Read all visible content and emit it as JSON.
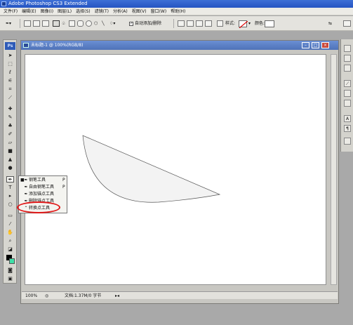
{
  "app": {
    "title": "Adobe Photoshop CS3 Extended"
  },
  "menu": [
    "文件(F)",
    "编辑(E)",
    "图像(I)",
    "图层(L)",
    "选择(S)",
    "滤镜(T)",
    "分析(A)",
    "视图(V)",
    "窗口(W)",
    "帮助(H)"
  ],
  "options": {
    "auto_add_delete_label": "自动添加/删除",
    "auto_add_delete_checked": true,
    "style_label": "样式:",
    "color_label": "颜色:"
  },
  "document": {
    "title": "未标题-1 @ 100%(RGB/8)",
    "zoom": "100%",
    "doc_info": "文档:1.37M/0 字节"
  },
  "flyout": {
    "items": [
      {
        "label": "钢笔工具",
        "shortcut": "P",
        "selected": true
      },
      {
        "label": "自由钢笔工具",
        "shortcut": "P",
        "selected": false
      },
      {
        "label": "添加锚点工具",
        "shortcut": "",
        "selected": false
      },
      {
        "label": "删除锚点工具",
        "shortcut": "",
        "selected": false
      },
      {
        "label": "转换点工具",
        "shortcut": "",
        "selected": false,
        "highlighted": true
      }
    ]
  },
  "colors": {
    "highlight_ring": "#e01818",
    "title_bar": "#2554c2",
    "canvas": "#ffffff"
  }
}
